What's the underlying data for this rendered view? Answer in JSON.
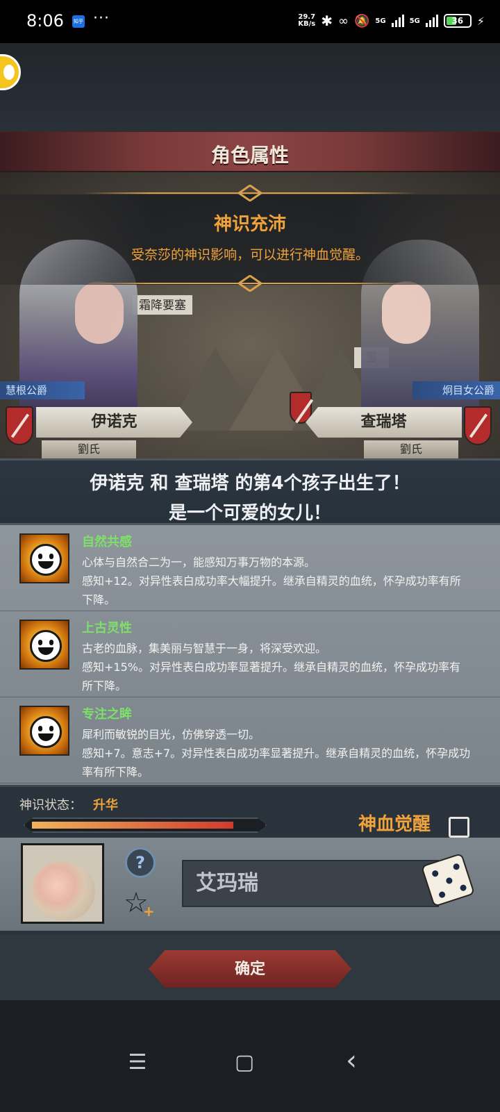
{
  "status_bar": {
    "time": "8:06",
    "app_badge": "知乎",
    "more": "···",
    "net_speed_value": "29.7",
    "net_speed_unit": "KB/s",
    "sig1": "5G",
    "sig2": "5G",
    "battery": "36"
  },
  "header": {
    "title": "角色属性"
  },
  "event": {
    "title": "神识充沛",
    "subtitle": "受奈莎的神识影响，可以进行神血觉醒。"
  },
  "map": {
    "label1": "霜降要塞",
    "label2": "雪"
  },
  "father": {
    "title": "慧根公爵",
    "name": "伊诺克",
    "clan": "劉氏"
  },
  "mother": {
    "title": "炯目女公爵",
    "name": "查瑞塔",
    "clan": "劉氏"
  },
  "announcement": {
    "line1": "伊诺克 和 查瑞塔 的第4个孩子出生了！",
    "line2": "是一个可爱的女儿！"
  },
  "traits": [
    {
      "name": "自然共感",
      "desc1": "心体与自然合二为一，能感知万事万物的本源。",
      "desc2": "感知+12。对异性表白成功率大幅提升。继承自精灵的血统，怀孕成功率有所下降。"
    },
    {
      "name": "上古灵性",
      "desc1": "古老的血脉，集美丽与智慧于一身，将深受欢迎。",
      "desc2": "感知+15%。对异性表白成功率显著提升。继承自精灵的血统，怀孕成功率有所下降。"
    },
    {
      "name": "专注之眸",
      "desc1": "犀利而敏锐的目光，仿佛穿透一切。",
      "desc2": "感知+7。意志+7。对异性表白成功率显著提升。继承自精灵的血统，怀孕成功率有所下降。"
    }
  ],
  "divine": {
    "label": "神识状态：",
    "value": "升华",
    "progress": 0.89,
    "awaken_label": "神血觉醒",
    "awaken_checked": false
  },
  "child": {
    "name_value": "艾玛瑞",
    "help_symbol": "?",
    "star_symbol": "☆",
    "plus_symbol": "+"
  },
  "confirm": {
    "label": "确定"
  },
  "nav": {
    "menu": "☰",
    "home": "▢",
    "back": "‹"
  },
  "colors": {
    "accent_orange": "#f0a33a",
    "trait_green": "#7de06a",
    "title_red": "#8b4444",
    "tag_blue": "#3a64a8"
  },
  "icons": [
    "app-avatar-icon",
    "shield-icon",
    "smile-icon",
    "help-icon",
    "star-add-icon",
    "dice-icon",
    "menu-icon",
    "home-icon",
    "back-icon",
    "battery-icon",
    "bluetooth-icon",
    "signal-icon"
  ]
}
